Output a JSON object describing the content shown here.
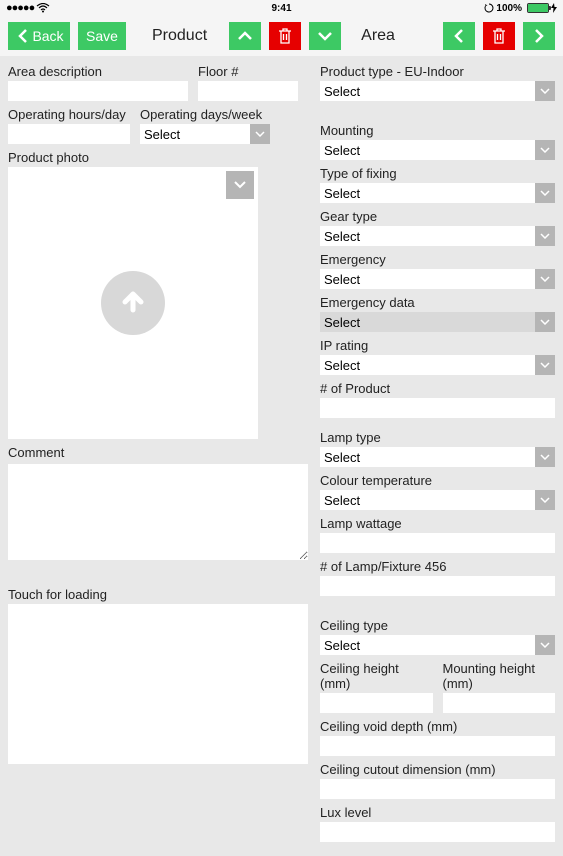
{
  "status": {
    "dots": "●●●●●",
    "time": "9:41",
    "battery_pct": "100%"
  },
  "toolbar": {
    "back": "Back",
    "save": "Save",
    "product_label": "Product",
    "area_label": "Area"
  },
  "left": {
    "area_desc_label": "Area description",
    "area_desc_value": "",
    "floor_label": "Floor #",
    "floor_value": "",
    "op_hours_label": "Operating hours/day",
    "op_hours_value": "",
    "op_days_label": "Operating days/week",
    "op_days_value": "Select",
    "photo_label": "Product photo",
    "comment_label": "Comment",
    "comment_value": "",
    "loading_label": "Touch for loading"
  },
  "right": {
    "product_type_label": "Product type - EU-Indoor",
    "product_type_value": "Select",
    "mounting_label": "Mounting",
    "mounting_value": "Select",
    "fixing_label": "Type of fixing",
    "fixing_value": "Select",
    "gear_label": "Gear type",
    "gear_value": "Select",
    "emergency_label": "Emergency",
    "emergency_value": "Select",
    "emergency_data_label": "Emergency data",
    "emergency_data_value": "Select",
    "ip_label": "IP rating",
    "ip_value": "Select",
    "num_product_label": "# of Product",
    "num_product_value": "",
    "lamp_type_label": "Lamp type",
    "lamp_type_value": "Select",
    "colour_temp_label": "Colour temperature",
    "colour_temp_value": "Select",
    "lamp_wattage_label": "Lamp wattage",
    "lamp_wattage_value": "",
    "num_lamp_label": "# of Lamp/Fixture 456",
    "num_lamp_value": "",
    "ceiling_type_label": "Ceiling type",
    "ceiling_type_value": "Select",
    "ceiling_height_label": "Ceiling height (mm)",
    "ceiling_height_value": "",
    "mounting_height_label": "Mounting height (mm)",
    "mounting_height_value": "",
    "void_depth_label": "Ceiling void depth (mm)",
    "void_depth_value": "",
    "cutout_label": "Ceiling cutout dimension (mm)",
    "cutout_value": "",
    "lux_label": "Lux level",
    "lux_value": ""
  }
}
